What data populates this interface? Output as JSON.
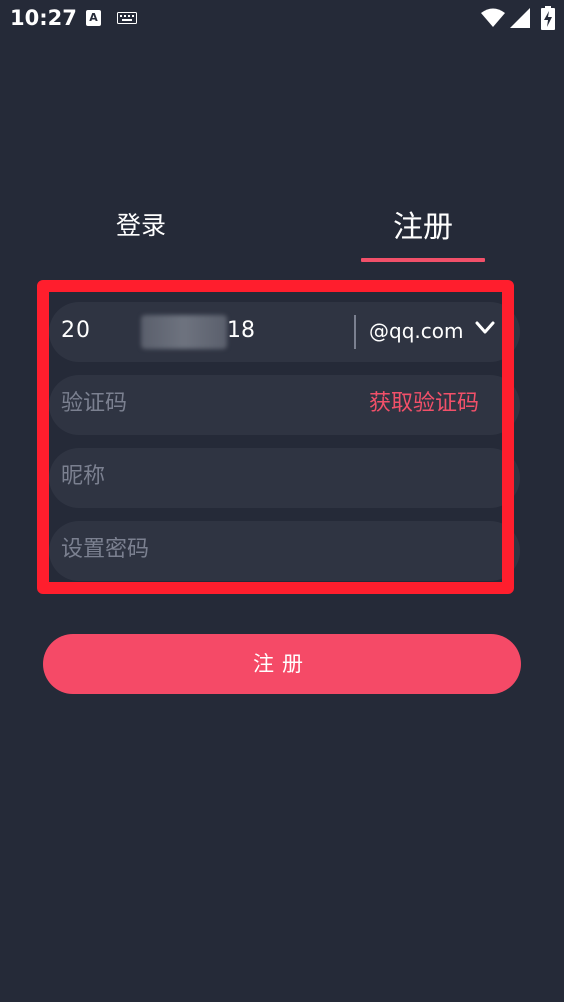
{
  "status_bar": {
    "time": "10:27",
    "notification_glyph": "A",
    "icons": [
      "keyboard-icon",
      "wifi-icon",
      "signal-icon",
      "battery-icon"
    ]
  },
  "tabs": {
    "login_label": "登录",
    "register_label": "注册",
    "active": "register"
  },
  "form": {
    "email_prefix": "20",
    "email_suffix": "18",
    "email_domain": "@qq.com",
    "code_placeholder": "验证码",
    "get_code_label": "获取验证码",
    "nickname_placeholder": "昵称",
    "password_placeholder": "设置密码"
  },
  "submit_label": "注册",
  "colors": {
    "background": "#252a38",
    "field": "#2f3442",
    "accent": "#f54a67",
    "highlight": "#ff1e2d",
    "placeholder": "#7b8090"
  }
}
